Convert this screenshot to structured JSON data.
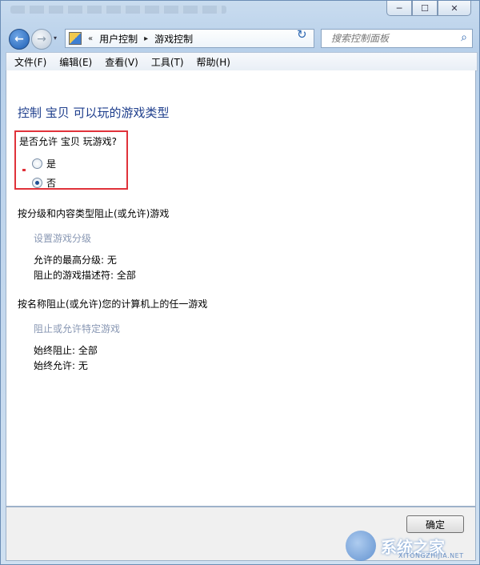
{
  "window": {
    "controls": {
      "minimize": "─",
      "maximize": "☐",
      "close": "✕"
    }
  },
  "address_bar": {
    "back_icon": "←",
    "forward_icon": "→",
    "overflow": "«",
    "sep": "▸",
    "crumbs": [
      "用户控制",
      "游戏控制"
    ],
    "dropdown": "▾",
    "refresh": "↻",
    "search_placeholder": "搜索控制面板",
    "search_icon": "⌕"
  },
  "menu": [
    "文件(F)",
    "编辑(E)",
    "查看(V)",
    "工具(T)",
    "帮助(H)"
  ],
  "page": {
    "title": "控制 宝贝 可以玩的游戏类型",
    "allow_question": "是否允许 宝贝 玩游戏?",
    "options": [
      {
        "label": "是",
        "checked": false
      },
      {
        "label": "否",
        "checked": true
      }
    ],
    "section1_head": "按分级和内容类型阻止(或允许)游戏",
    "section1_link": "设置游戏分级",
    "max_rating": "允许的最高分级: 无",
    "blocked_desc": "阻止的游戏描述符: 全部",
    "section2_head": "按名称阻止(或允许)您的计算机上的任一游戏",
    "section2_link": "阻止或允许特定游戏",
    "always_block": "始终阻止: 全部",
    "always_allow": "始终允许: 无"
  },
  "footer": {
    "ok": "确定"
  },
  "watermark": {
    "text": "系统之家",
    "url": "XITONGZHIJIA.NET"
  },
  "colors": {
    "title_blue": "#1e3e8c",
    "highlight_red": "#e0323a",
    "link_gray": "#8897b3"
  }
}
